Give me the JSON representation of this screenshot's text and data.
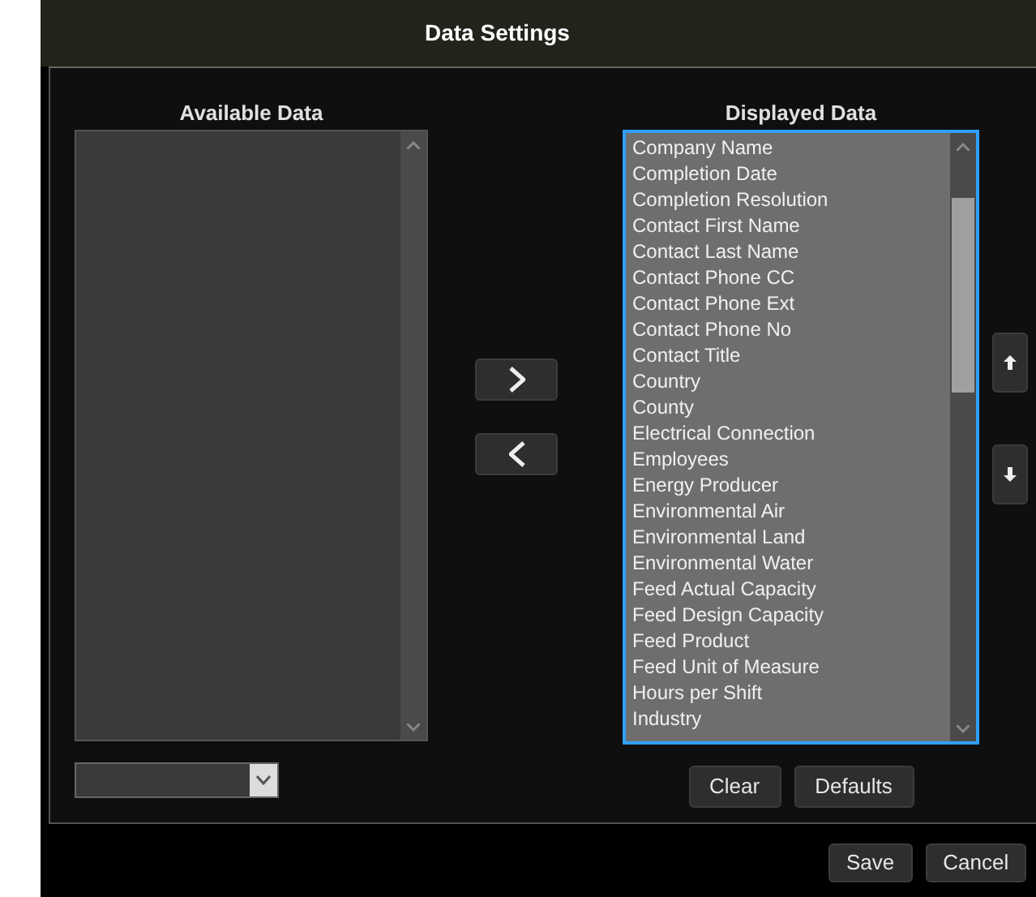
{
  "window": {
    "title": "Data Settings"
  },
  "available": {
    "heading": "Available Data"
  },
  "displayed": {
    "heading": "Displayed Data",
    "items": [
      "Company Name",
      "Completion Date",
      "Completion Resolution",
      "Contact First Name",
      "Contact Last Name",
      "Contact Phone CC",
      "Contact Phone Ext",
      "Contact Phone No",
      "Contact Title",
      "Country",
      "County",
      "Electrical Connection",
      "Employees",
      "Energy Producer",
      "Environmental Air",
      "Environmental Land",
      "Environmental Water",
      "Feed Actual Capacity",
      "Feed Design Capacity",
      "Feed Product",
      "Feed Unit of Measure",
      "Hours per Shift",
      "Industry"
    ]
  },
  "list_buttons": [
    "Clear",
    "Defaults"
  ],
  "footer_buttons": [
    "Save",
    "Cancel"
  ]
}
